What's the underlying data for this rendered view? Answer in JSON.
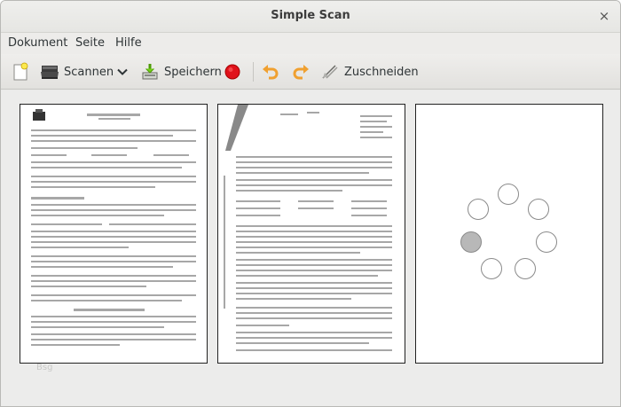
{
  "window": {
    "title": "Simple Scan",
    "close_glyph": "×"
  },
  "menu": [
    {
      "label": "Dokument"
    },
    {
      "label": "Seite"
    },
    {
      "label": "Hilfe"
    }
  ],
  "toolbar": {
    "new_icon": "new-document-icon",
    "scan_label": "Scannen",
    "scan_icon": "scanner-icon",
    "scan_dropdown_icon": "chevron-down-icon",
    "save_label": "Speichern",
    "save_icon": "save-icon",
    "stop_icon": "stop-record-icon",
    "rotate_left_icon": "rotate-left-icon",
    "rotate_right_icon": "rotate-right-icon",
    "crop_label": "Zuschneiden",
    "crop_icon": "crop-icon"
  },
  "pages": [
    {
      "state": "scanned"
    },
    {
      "state": "scanned"
    },
    {
      "state": "scanning"
    }
  ],
  "caption": "Bsg",
  "colors": {
    "stop_red": "#e0121b",
    "rotate_orange": "#f0a030",
    "save_green": "#6aa84f",
    "spinner_active": "#b8b8b8"
  }
}
